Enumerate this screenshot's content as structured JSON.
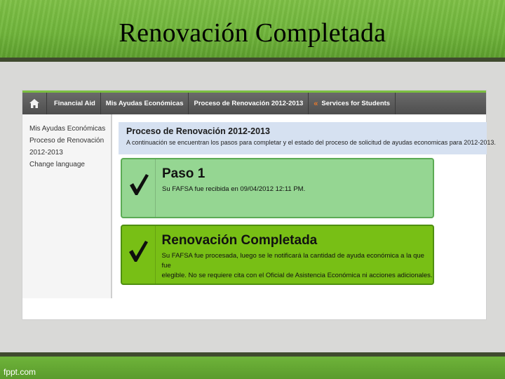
{
  "slide": {
    "title": "Renovación Completada",
    "watermark": "fppt.com"
  },
  "navbar": {
    "items": [
      "Financial Aid",
      "Mis Ayudas Económicas",
      "Proceso de Renovación 2012-2013",
      "Services for Students"
    ],
    "arrows": "«",
    "home_icon": "home-icon"
  },
  "sidebar": {
    "items": [
      "Mis Ayudas Económicas",
      "Proceso de Renovación",
      "2012-2013",
      "Change language"
    ]
  },
  "content": {
    "title": "Proceso de Renovación 2012-2013",
    "subtitle": "A continuación se encuentran los pasos para completar y el estado del proceso de solicitud de ayudas economicas para 2012-2013."
  },
  "steps": [
    {
      "title": "Paso 1",
      "text_lines": [
        "Su FAFSA fue recibida en 09/04/2012 12:11 PM."
      ]
    },
    {
      "title": "Renovación Completada",
      "text_lines": [
        "Su FAFSA fue procesada, luego se le notificará la cantidad de ayuda económica a la que fue",
        "elegible. No se requiere cita con el Oficial de Asistencia Económica ni acciones adicionales."
      ]
    }
  ],
  "colors": {
    "green_band": "#6fb43a",
    "step1_bg": "#95d692",
    "step2_bg": "#78bf15",
    "accent_orange": "#e8782a"
  }
}
